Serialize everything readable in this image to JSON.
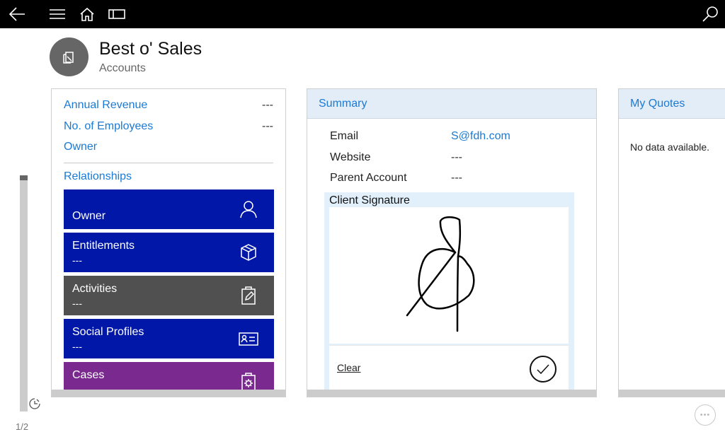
{
  "topbar": {
    "icons": [
      "back-arrow-icon",
      "hamburger-menu-icon",
      "home-icon",
      "panel-icon",
      "search-icon"
    ]
  },
  "header": {
    "title": "Best o' Sales",
    "subtitle": "Accounts",
    "avatar_icon": "account-icon"
  },
  "details_card": {
    "fields": [
      {
        "label": "Annual Revenue",
        "value": "---"
      },
      {
        "label": "No. of Employees",
        "value": "---"
      },
      {
        "label": "Owner",
        "value": ""
      }
    ],
    "section_label": "Relationships",
    "tiles": [
      {
        "label": "Owner",
        "sub": "",
        "icon": "person-icon",
        "color": "#0017a8"
      },
      {
        "label": "Entitlements",
        "sub": "---",
        "icon": "package-icon",
        "color": "#0017a8"
      },
      {
        "label": "Activities",
        "sub": "---",
        "icon": "clipboard-edit-icon",
        "color": "#505050"
      },
      {
        "label": "Social Profiles",
        "sub": "---",
        "icon": "contact-card-icon",
        "color": "#0017a8"
      },
      {
        "label": "Cases",
        "sub": "---",
        "icon": "clipboard-gear-icon",
        "color": "#7a2a8e"
      }
    ]
  },
  "summary_card": {
    "title": "Summary",
    "fields": [
      {
        "label": "Email",
        "value": "S@fdh.com",
        "is_link": true
      },
      {
        "label": "Website",
        "value": "---",
        "is_link": false
      },
      {
        "label": "Parent Account",
        "value": "---",
        "is_link": false
      }
    ],
    "signature": {
      "label": "Client Signature",
      "clear_label": "Clear",
      "confirm_icon": "checkmark-circle-icon"
    }
  },
  "quotes_card": {
    "title": "My Quotes",
    "empty_text": "No data available."
  },
  "pager": {
    "page_indicator": "1/2",
    "scroll_position": 0
  },
  "colors": {
    "accent": "#1a7ad4",
    "topbar": "#000000",
    "tile_blue": "#0017a8",
    "tile_gray": "#505050",
    "tile_purple": "#7a2a8e",
    "card_header": "#e3edf8"
  }
}
